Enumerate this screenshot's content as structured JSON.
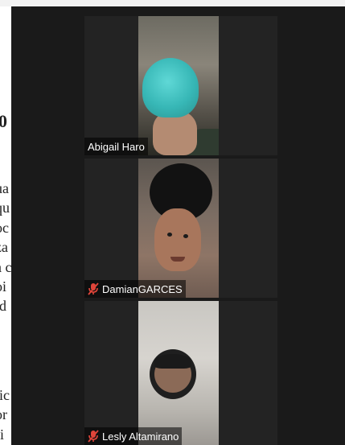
{
  "document": {
    "heading": "0",
    "lines_a": [
      "ua",
      "qu",
      "oc",
      "za",
      "a c",
      "oi",
      "id"
    ],
    "lines_b": [
      "lic",
      "or",
      "fi"
    ]
  },
  "participants": [
    {
      "name": "Abigail Haro",
      "muted": false
    },
    {
      "name": "DamianGARCES",
      "muted": true
    },
    {
      "name": "Lesly Altamirano",
      "muted": true
    }
  ],
  "colors": {
    "window_bg": "#1a1a1a",
    "tile_bg": "#232323",
    "muted_icon": "#e0453a"
  }
}
